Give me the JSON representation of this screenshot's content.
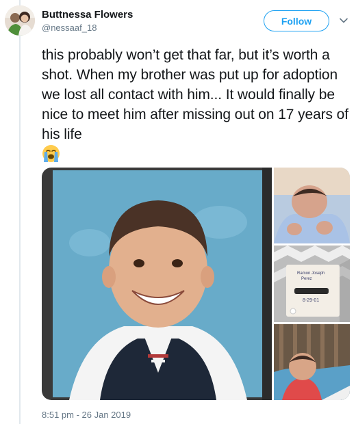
{
  "user": {
    "display_name": "Buttnessa Flowers",
    "handle": "@nessaaf_18",
    "avatar_icon": "profile-photo"
  },
  "actions": {
    "follow_label": "Follow",
    "more_icon": "chevron-down-icon"
  },
  "tweet": {
    "text": "this probably won’t get that far, but it’s worth a shot. When my brother was put up for adoption we lost all contact with him... It would finally be nice to meet him after missing out on 17 years of his life",
    "emoji": "loudly-crying-face",
    "timestamp": "8:51 pm - 26 Jan 2019"
  },
  "media": {
    "photo_count": 4,
    "card_text": [
      "Ramon Joseph",
      "Perez",
      "8-29-01"
    ]
  },
  "colors": {
    "accent": "#1da1f2",
    "secondary_text": "#657786",
    "primary_text": "#14171a",
    "thread_line": "#e1e8ed"
  }
}
